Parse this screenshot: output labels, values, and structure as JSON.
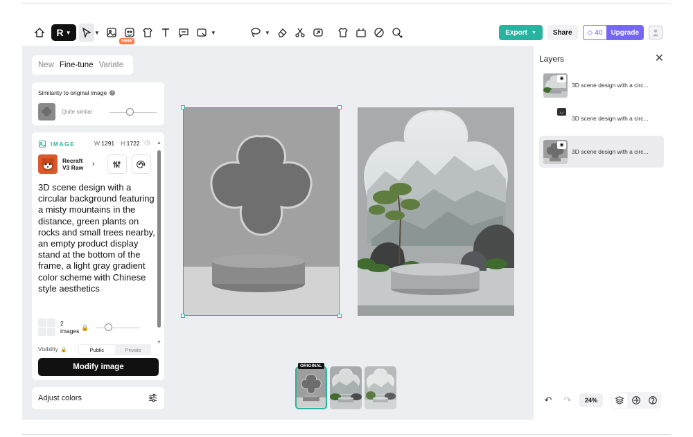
{
  "toolbar": {
    "new_badge": "NEW",
    "export_label": "Export",
    "share_label": "Share",
    "credits": "40",
    "upgrade_label": "Upgrade"
  },
  "left": {
    "tabs": [
      "New",
      "Fine-tune",
      "Variate"
    ],
    "similarity_title": "Similarity to original image",
    "similarity_value": "Quite similar",
    "section_label": "IMAGE",
    "width_label": "W:",
    "width": "1291",
    "height_label": "H:",
    "height": "1722",
    "model_name": "Recraft V3 Raw",
    "prompt": "3D scene design with a circular background featuring a misty mountains in the distance, green plants on rocks and small trees nearby, an empty product display stand at the bottom of the frame, a light gray gradient color scheme with Chinese style aesthetics",
    "images_count": "2",
    "images_label": "images",
    "visibility_label": "Visibility",
    "visibility_options": [
      "Public",
      "Private"
    ],
    "modify_button": "Modify image",
    "adjust_colors": "Adjust colors"
  },
  "canvas": {
    "original_tag": "ORIGINAL"
  },
  "layers": {
    "title": "Layers",
    "items": [
      {
        "name": "3D scene design with a circ..."
      },
      {
        "name": "3D scene design with a circ..."
      },
      {
        "name": "3D scene design with a circ..."
      }
    ],
    "zoom": "24%"
  },
  "colors": {
    "accent": "#28b3a0",
    "upgrade": "#7467f3"
  }
}
